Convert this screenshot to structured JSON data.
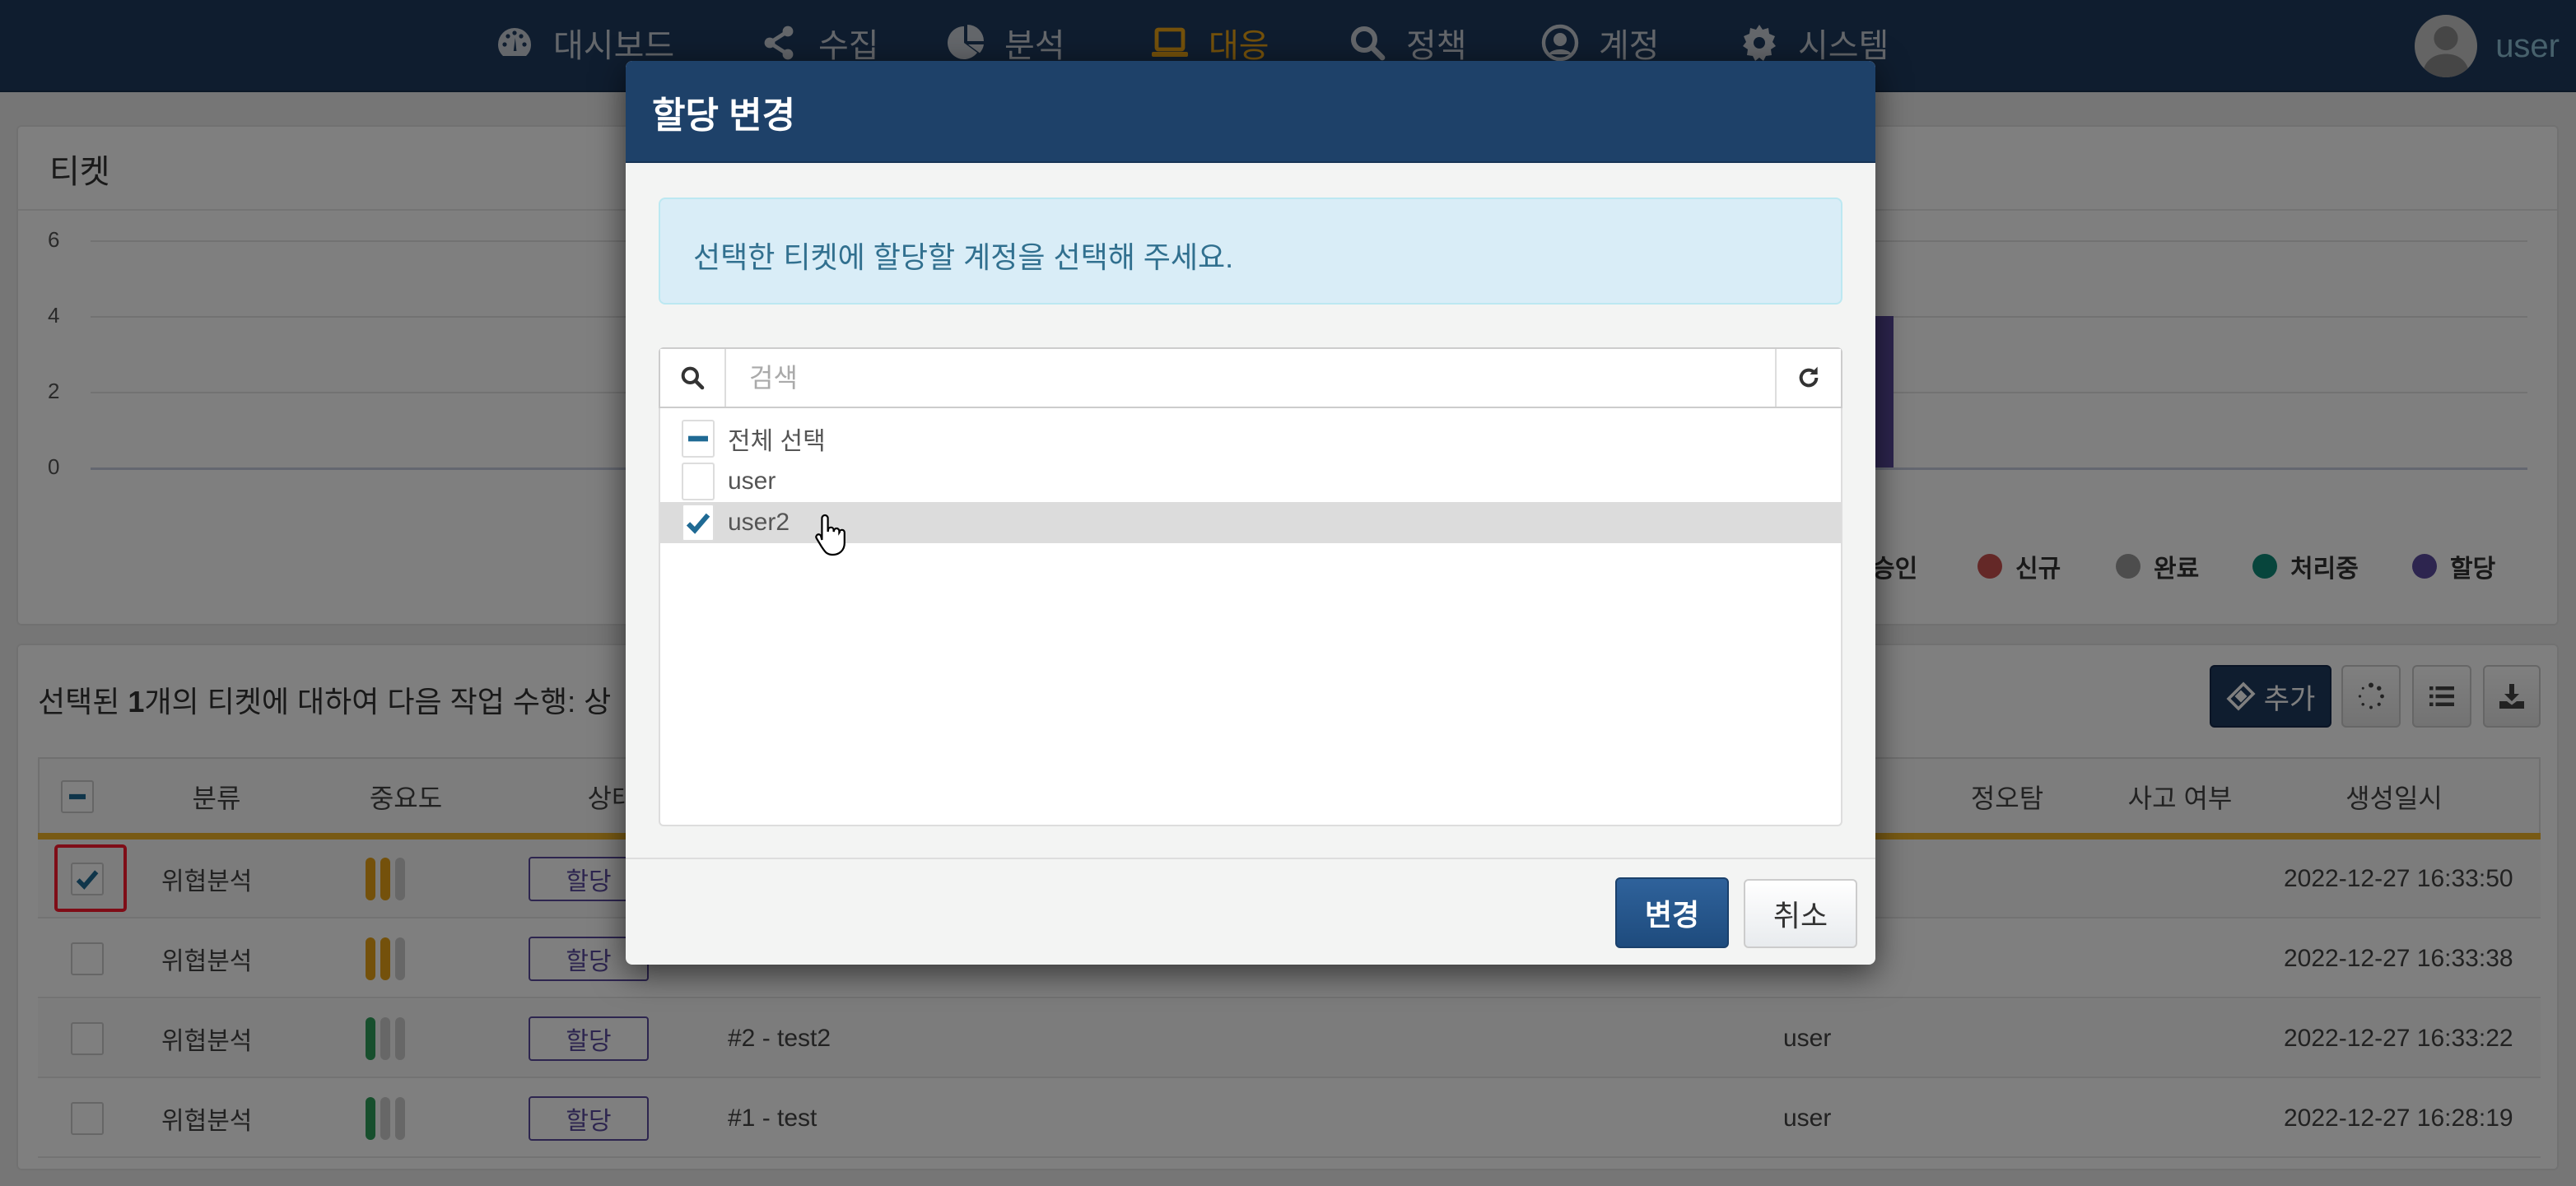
{
  "navbar": {
    "items": [
      {
        "label": "대시보드",
        "icon": "dashboard-icon",
        "active": false
      },
      {
        "label": "수집",
        "icon": "share-icon",
        "active": false
      },
      {
        "label": "분석",
        "icon": "pie-chart-icon",
        "active": false
      },
      {
        "label": "대응",
        "icon": "laptop-icon",
        "active": true
      },
      {
        "label": "정책",
        "icon": "search-icon",
        "active": false
      },
      {
        "label": "계정",
        "icon": "user-circle-icon",
        "active": false
      },
      {
        "label": "시스템",
        "icon": "gear-icon",
        "active": false
      }
    ],
    "user": "user",
    "active_color": "#e8a317"
  },
  "chart_panel": {
    "title": "티켓"
  },
  "chart_data": {
    "type": "bar",
    "title": "티켓",
    "yticks": [
      "6",
      "4",
      "2",
      "0"
    ],
    "ylim": [
      0,
      6
    ],
    "series": [
      {
        "name": "할당",
        "values": [
          4
        ],
        "color": "#5a4a9e"
      }
    ],
    "legend": [
      {
        "label": "승인",
        "color": "#2e9e5b"
      },
      {
        "label": "신규",
        "color": "#c9504f"
      },
      {
        "label": "완료",
        "color": "#9a9a9a"
      },
      {
        "label": "처리중",
        "color": "#0e8a78"
      },
      {
        "label": "할당",
        "color": "#5a4a9e"
      }
    ],
    "legend_position": "bottom-right",
    "grid": true
  },
  "table_panel": {
    "action_prefix": "선택된 ",
    "selected_count": "1",
    "action_suffix": "개의 티켓에 대하여 다음 작업 수행: 상",
    "add_button": "추가",
    "columns": [
      "분류",
      "중요도",
      "상태",
      "정오탐",
      "사고 여부",
      "생성일시"
    ],
    "rows": [
      {
        "checked": true,
        "category": "위협분석",
        "severity": 2,
        "severity_color": "#e8a317",
        "status": "할당",
        "title": "",
        "assignee": "",
        "created": "2022-12-27 16:33:50"
      },
      {
        "checked": false,
        "category": "위협분석",
        "severity": 2,
        "severity_color": "#e8a317",
        "status": "할당",
        "title": "",
        "assignee": "",
        "created": "2022-12-27 16:33:38"
      },
      {
        "checked": false,
        "category": "위협분석",
        "severity": 1,
        "severity_color": "#2e9e5b",
        "status": "할당",
        "title": "#2 - test2",
        "assignee": "user",
        "created": "2022-12-27 16:33:22"
      },
      {
        "checked": false,
        "category": "위협분석",
        "severity": 1,
        "severity_color": "#2e9e5b",
        "status": "할당",
        "title": "#1 - test",
        "assignee": "user",
        "created": "2022-12-27 16:28:19"
      }
    ]
  },
  "modal": {
    "title": "할당 변경",
    "info": "선택한 티켓에 할당할 계정을 선택해 주세요.",
    "search_placeholder": "검색",
    "search_value": "",
    "select_all_label": "전체 선택",
    "accounts": [
      {
        "label": "user",
        "checked": false
      },
      {
        "label": "user2",
        "checked": true
      }
    ],
    "confirm_label": "변경",
    "cancel_label": "취소"
  }
}
